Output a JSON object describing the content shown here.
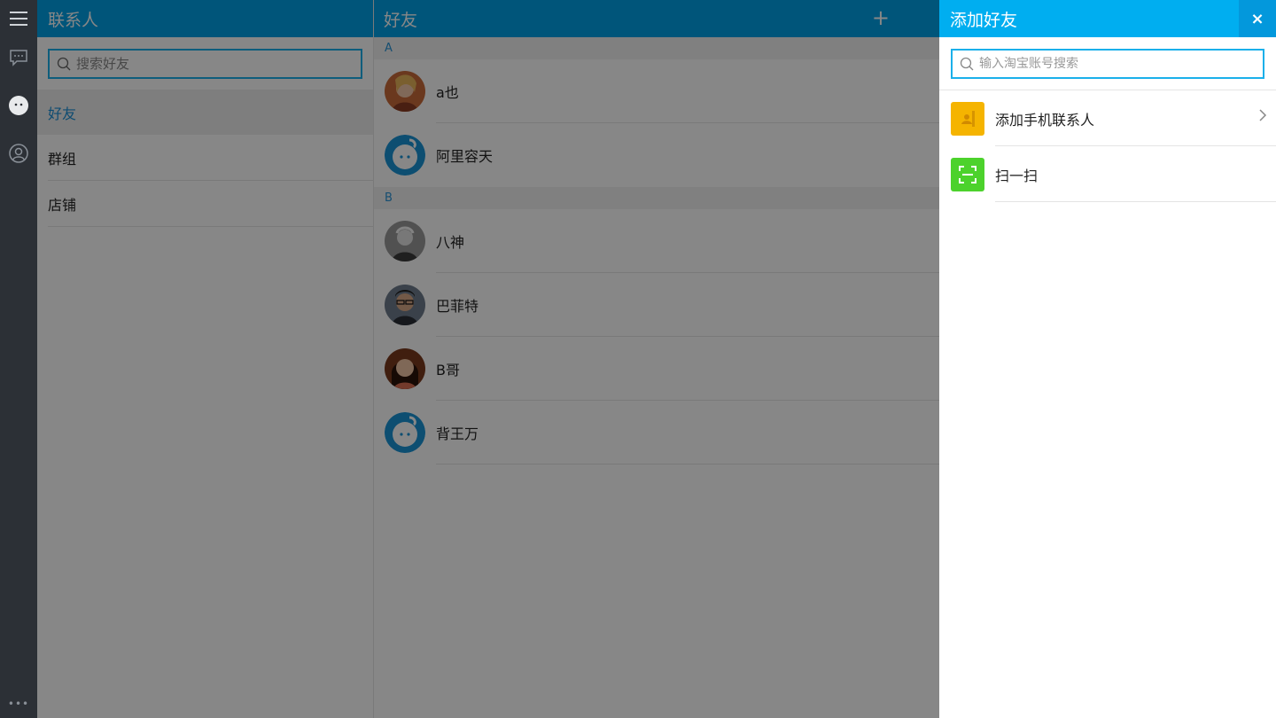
{
  "rail": {
    "more_label": "•••"
  },
  "contacts": {
    "title": "联系人",
    "search_placeholder": "搜索好友",
    "categories": [
      {
        "label": "好友"
      },
      {
        "label": "群组"
      },
      {
        "label": "店铺"
      }
    ]
  },
  "friends": {
    "title": "好友",
    "add_label": "+",
    "groups": [
      {
        "letter": "A",
        "items": [
          {
            "name": "a也"
          },
          {
            "name": "阿里容天"
          }
        ]
      },
      {
        "letter": "B",
        "items": [
          {
            "name": "八神"
          },
          {
            "name": "巴菲特"
          },
          {
            "name": "B哥"
          },
          {
            "name": "背王万"
          }
        ]
      }
    ]
  },
  "panel": {
    "title": "添加好友",
    "close_label": "×",
    "search_placeholder": "输入淘宝账号搜索",
    "items": [
      {
        "label": "添加手机联系人",
        "icon": "contact-book-icon",
        "color": "#f5b400"
      },
      {
        "label": "扫一扫",
        "icon": "scan-icon",
        "color": "#4cd22c"
      }
    ]
  },
  "colors": {
    "accent": "#00a0e6",
    "panel_header": "#00aef0",
    "link": "#1a8fd6"
  }
}
